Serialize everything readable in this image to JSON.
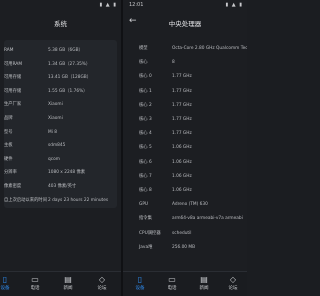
{
  "left_pane": {
    "status": {
      "time": "",
      "icons": "▮ ▲ ▮"
    },
    "title": "系统",
    "rows": [
      {
        "k": "RAM",
        "v": "5.38 GB（6GB）"
      },
      {
        "k": "可用RAM",
        "v": "1.34 GB（27.35%）"
      },
      {
        "k": "可用存储",
        "v": "13.41 GB（128GB）"
      },
      {
        "k": "可用存储",
        "v": "1.55 GB（1.76%）"
      },
      {
        "k": "生产厂家",
        "v": "Xiaomi"
      },
      {
        "k": "品牌",
        "v": "Xiaomi"
      },
      {
        "k": "型号",
        "v": "Mi 8"
      },
      {
        "k": "主板",
        "v": "sdm845"
      },
      {
        "k": "硬件",
        "v": "qcom"
      },
      {
        "k": "分辨率",
        "v": "1080 x 2248 像素"
      },
      {
        "k": "像素密度",
        "v": "403 像素/英寸"
      },
      {
        "k": "自上次启动以来的时间",
        "v": "2 days 23 hours 22 minutes"
      }
    ]
  },
  "right_pane": {
    "status": {
      "time": "12:01",
      "icons": "▮ ▲ ▮"
    },
    "title": "中央处理器",
    "rows": [
      {
        "k": "模型",
        "v": "Octa-Core 2.80 GHz Qualcomm Technologies, Inc SDM845"
      },
      {
        "k": "核心",
        "v": "8"
      },
      {
        "k": "核心 0",
        "v": "1.77 GHz"
      },
      {
        "k": "核心 1",
        "v": "1.77 GHz"
      },
      {
        "k": "核心 2",
        "v": "1.77 GHz"
      },
      {
        "k": "核心 3",
        "v": "1.77 GHz"
      },
      {
        "k": "核心 4",
        "v": "1.77 GHz"
      },
      {
        "k": "核心 5",
        "v": "1.06 GHz"
      },
      {
        "k": "核心 6",
        "v": "1.06 GHz"
      },
      {
        "k": "核心 7",
        "v": "1.06 GHz"
      },
      {
        "k": "核心 8",
        "v": "1.06 GHz"
      },
      {
        "k": "GPU",
        "v": "Adreno (TM) 630"
      },
      {
        "k": "指令集",
        "v": "arm64-v8a armeabi-v7a armeabi"
      },
      {
        "k": "CPU调控器",
        "v": "schedutil"
      },
      {
        "k": "Java堆",
        "v": "256.00 MB"
      }
    ]
  },
  "nav": [
    {
      "label": "设备",
      "icon": "▯"
    },
    {
      "label": "电话",
      "icon": "▭"
    },
    {
      "label": "新闻",
      "icon": "▤"
    },
    {
      "label": "论坛",
      "icon": "◇"
    }
  ]
}
